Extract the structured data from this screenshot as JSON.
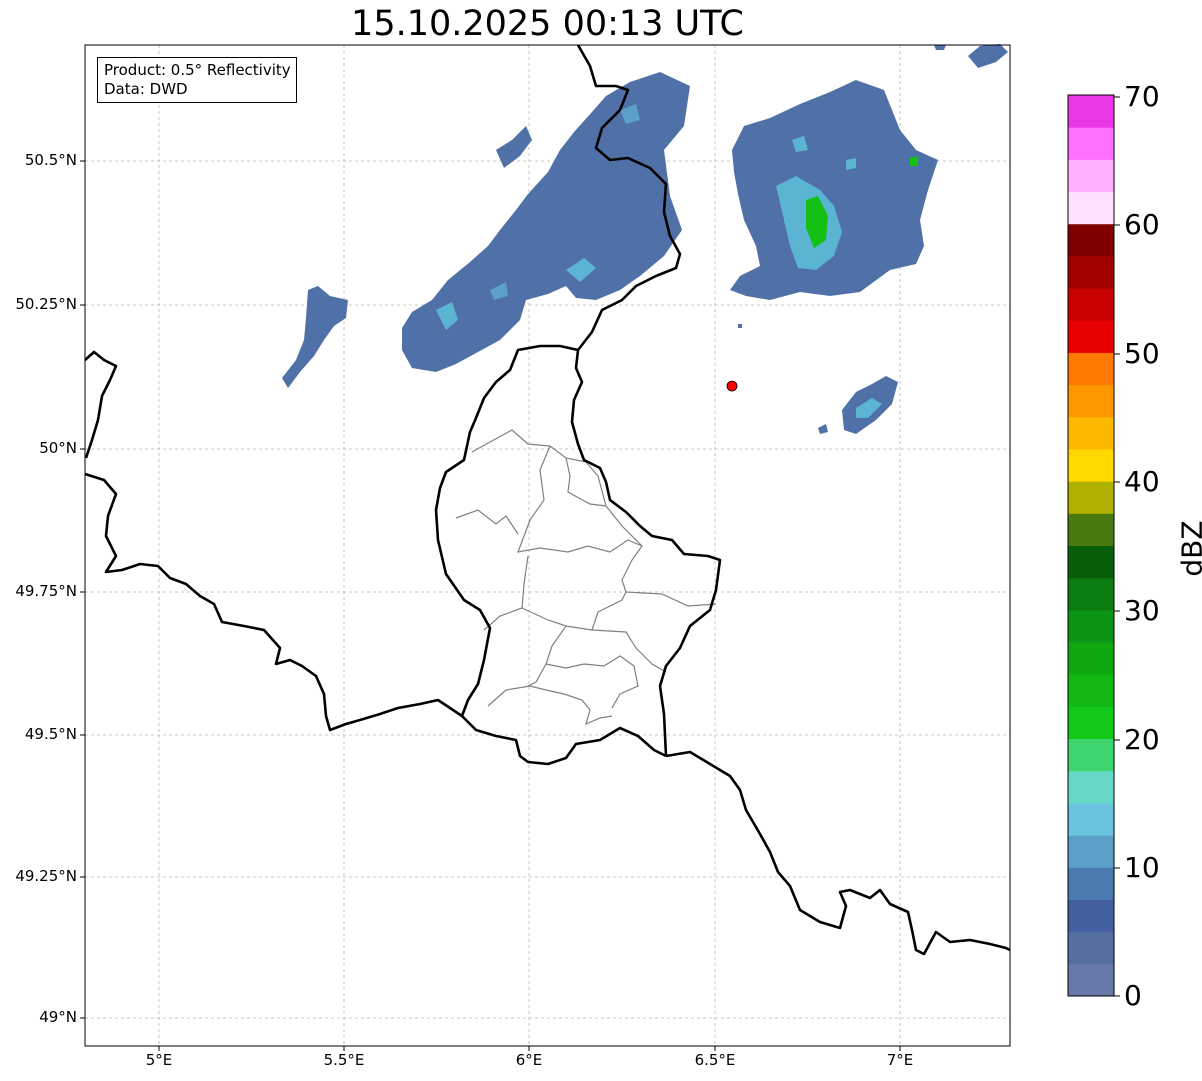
{
  "title": "15.10.2025 00:13 UTC",
  "info": {
    "product": "Product: 0.5° Reflectivity",
    "data": "Data: DWD"
  },
  "axes": {
    "lat_labels": [
      "50.5°N",
      "50.25°N",
      "50°N",
      "49.75°N",
      "49.5°N",
      "49.25°N",
      "49°N"
    ],
    "lon_labels": [
      "5°E",
      "5.5°E",
      "6°E",
      "6.5°E",
      "7°E"
    ]
  },
  "colorbar": {
    "unit": "dBZ",
    "ticks": [
      "0",
      "10",
      "20",
      "30",
      "40",
      "50",
      "60",
      "70"
    ],
    "colors": [
      "#6878a8",
      "#5470a0",
      "#4560a0",
      "#4a7ab0",
      "#5aa0c8",
      "#6ac4e0",
      "#64d8c4",
      "#3ed46e",
      "#12c818",
      "#14b814",
      "#10a810",
      "#0c9414",
      "#0a7c10",
      "#065e0a",
      "#487a10",
      "#b0b000",
      "#ffd800",
      "#ffb800",
      "#ff9800",
      "#ff7800",
      "#e80000",
      "#c80000",
      "#a00000",
      "#800000",
      "#ffe0ff",
      "#ffb0ff",
      "#ff70ff",
      "#e838e8"
    ]
  },
  "radar_site": {
    "color": "#ff0000"
  }
}
